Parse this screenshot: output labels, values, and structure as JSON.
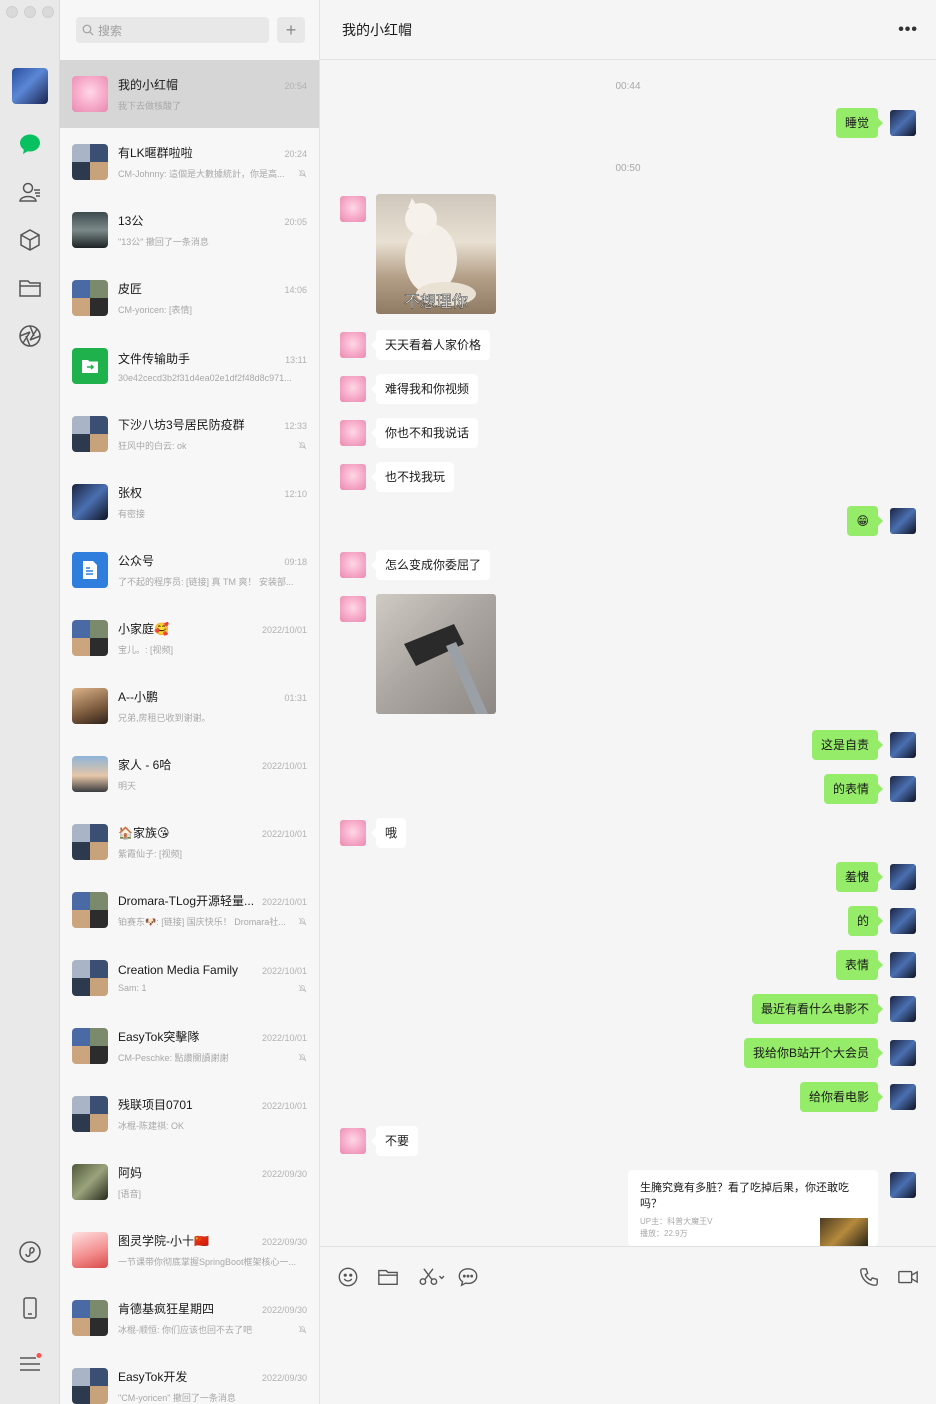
{
  "window": {
    "controls": [
      "close",
      "minimize",
      "zoom"
    ]
  },
  "rail": {
    "icons": [
      "chat-icon",
      "contacts-icon",
      "favorites-cube-icon",
      "folder-icon",
      "moments-aperture-icon",
      "miniprogram-icon",
      "phone-icon",
      "menu-icon"
    ],
    "accent": "#07c160",
    "notification_dot": "#fa5151"
  },
  "search": {
    "placeholder": "搜索",
    "add_label": "+"
  },
  "chats": [
    {
      "name": "我的小红帽",
      "time": "20:54",
      "preview": "我下去做核酸了",
      "avatar": "pink",
      "muted": false,
      "active": true
    },
    {
      "name": "有LK暱群啦啦",
      "time": "20:24",
      "preview": "CM-Johnny: 這個是大數據統計，你是高...",
      "avatar": "grid",
      "muted": true
    },
    {
      "name": "13公",
      "time": "20:05",
      "preview": "\"13公\" 撤回了一条消息",
      "avatar": "man",
      "muted": false
    },
    {
      "name": "皮匠",
      "time": "14:06",
      "preview": "CM-yoricen: [表情]",
      "avatar": "grid2",
      "muted": false
    },
    {
      "name": "文件传输助手",
      "time": "13:11",
      "preview": "30e42cecd3b2f31d4ea02e1df2f48d8c971...",
      "avatar": "green",
      "muted": false
    },
    {
      "name": "下沙八坊3号居民防疫群",
      "time": "12:33",
      "preview": "狂风中的白云: ok",
      "avatar": "grid",
      "muted": true
    },
    {
      "name": "张权",
      "time": "12:10",
      "preview": "有密接",
      "avatar": "dark",
      "muted": false
    },
    {
      "name": "公众号",
      "time": "09:18",
      "preview": "了不起的程序员: [链接] 真 TM 爽！ 安装部...",
      "avatar": "blue",
      "muted": false
    },
    {
      "name": "小家庭🥰",
      "time": "2022/10/01",
      "preview": "宝儿。: [视频]",
      "avatar": "grid2",
      "muted": false
    },
    {
      "name": "A--小鹏",
      "time": "01:31",
      "preview": "兄弟,房租已收到谢谢。",
      "avatar": "face",
      "muted": false
    },
    {
      "name": "家人 - 6哈",
      "time": "2022/10/01",
      "preview": "明天",
      "avatar": "sky",
      "muted": false
    },
    {
      "name": "🏠家族😘",
      "time": "2022/10/01",
      "preview": "紫霞仙子: [视频]",
      "avatar": "grid",
      "muted": false
    },
    {
      "name": "Dromara-TLog开源轻量...",
      "time": "2022/10/01",
      "preview": "铂赛东🐶: [链接] 国庆快乐！ Dromara社...",
      "avatar": "grid2",
      "muted": true
    },
    {
      "name": "Creation Media Family",
      "time": "2022/10/01",
      "preview": "Sam: 1",
      "avatar": "grid",
      "muted": true
    },
    {
      "name": "EasyTok突擊隊",
      "time": "2022/10/01",
      "preview": "CM-Peschke: 點讚關讀謝謝",
      "avatar": "grid2",
      "muted": true
    },
    {
      "name": "残联项目0701",
      "time": "2022/10/01",
      "preview": "冰棍-陈建祺: OK",
      "avatar": "grid",
      "muted": false
    },
    {
      "name": "阿妈",
      "time": "2022/09/30",
      "preview": "[语音]",
      "avatar": "plant",
      "muted": false
    },
    {
      "name": "图灵学院-小十🇨🇳",
      "time": "2022/09/30",
      "preview": "一节课带你彻底掌握SpringBoot框架核心一...",
      "avatar": "red",
      "muted": false
    },
    {
      "name": "肯德基疯狂星期四",
      "time": "2022/09/30",
      "preview": "冰棍-顺恒: 你们应该也回不去了吧",
      "avatar": "grid2",
      "muted": true
    },
    {
      "name": "EasyTok开发",
      "time": "2022/09/30",
      "preview": "\"CM-yoricen\" 撤回了一条消息",
      "avatar": "grid",
      "muted": false
    }
  ],
  "conversation": {
    "title": "我的小红帽",
    "more_label": "•••",
    "timestamps": [
      "00:44",
      "00:50"
    ],
    "messages": [
      {
        "side": "out",
        "type": "text",
        "text": "睡觉"
      },
      {
        "side": "in",
        "type": "image",
        "caption": "不想理你",
        "subject": "cat"
      },
      {
        "side": "in",
        "type": "text",
        "text": "天天看着人家价格"
      },
      {
        "side": "in",
        "type": "text",
        "text": "难得我和你视频"
      },
      {
        "side": "in",
        "type": "text",
        "text": "你也不和我说话"
      },
      {
        "side": "in",
        "type": "text",
        "text": "也不找我玩"
      },
      {
        "side": "out",
        "type": "text",
        "text": "😁"
      },
      {
        "side": "in",
        "type": "text",
        "text": "怎么变成你委屈了"
      },
      {
        "side": "in",
        "type": "image",
        "caption": "",
        "subject": "hammer"
      },
      {
        "side": "out",
        "type": "text",
        "text": "这是自责"
      },
      {
        "side": "out",
        "type": "text",
        "text": "的表情"
      },
      {
        "side": "in",
        "type": "text",
        "text": "哦"
      },
      {
        "side": "out",
        "type": "text",
        "text": "羞愧"
      },
      {
        "side": "out",
        "type": "text",
        "text": "的"
      },
      {
        "side": "out",
        "type": "text",
        "text": "表情"
      },
      {
        "side": "out",
        "type": "text",
        "text": "最近有看什么电影不"
      },
      {
        "side": "out",
        "type": "text",
        "text": "我给你B站开个大会员"
      },
      {
        "side": "out",
        "type": "text",
        "text": "给你看电影"
      },
      {
        "side": "in",
        "type": "text",
        "text": "不要"
      },
      {
        "side": "out",
        "type": "link",
        "title": "生腌究竟有多脏？看了吃掉后果，你还敢吃吗？",
        "uploader": "UP主：科普大魔王V",
        "plays": "播放：22.9万"
      }
    ]
  },
  "composer": {
    "tools": [
      "emoji-icon",
      "folder-icon",
      "scissors-icon",
      "chat-bubble-icon"
    ],
    "right_tools": [
      "voice-call-icon",
      "video-call-icon"
    ]
  }
}
